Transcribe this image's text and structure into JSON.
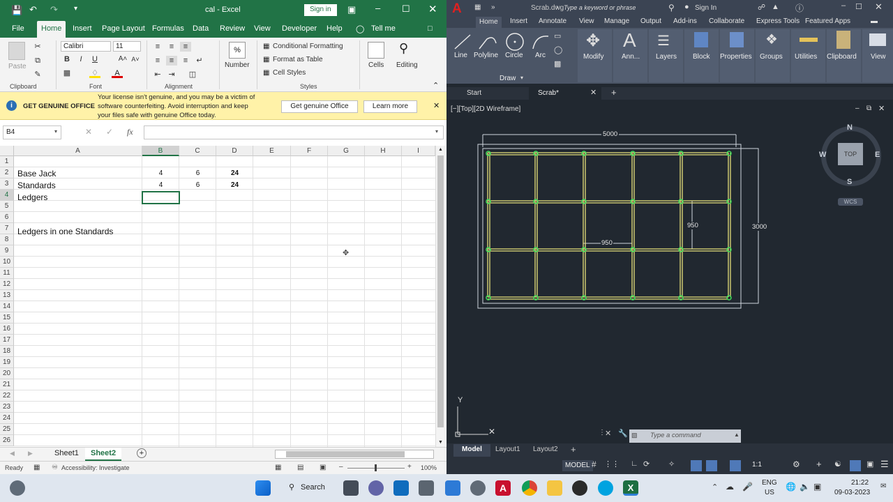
{
  "excel": {
    "title": "cal  -  Excel",
    "sign_in": "Sign in",
    "tabs": [
      "File",
      "Home",
      "Insert",
      "Page Layout",
      "Formulas",
      "Data",
      "Review",
      "View",
      "Developer",
      "Help",
      "Tell me"
    ],
    "font_name": "Calibri",
    "font_size": "11",
    "ribbon": {
      "paste": "Paste",
      "number": "Number",
      "percent": "%",
      "conditional": "Conditional Formatting",
      "format_table": "Format as Table",
      "cell_styles": "Cell Styles",
      "cells": "Cells",
      "editing": "Editing",
      "groups": [
        "Clipboard",
        "Font",
        "Alignment",
        "Styles"
      ]
    },
    "banner": {
      "title": "GET GENUINE OFFICE",
      "message_1": "Your license isn't genuine, and you may be a victim of",
      "message_2": "software counterfeiting. Avoid interruption and keep",
      "message_3": "your files safe with genuine Office today.",
      "btn_genuine": "Get genuine Office",
      "btn_learn": "Learn more"
    },
    "namebox": "B4",
    "fx": "fx",
    "columns": [
      "A",
      "B",
      "C",
      "D",
      "E",
      "F",
      "G",
      "H",
      "I"
    ],
    "rows": [
      "1",
      "2",
      "3",
      "4",
      "5",
      "6",
      "7",
      "8",
      "9",
      "10",
      "11",
      "12",
      "13",
      "14",
      "15",
      "16",
      "17",
      "18",
      "19",
      "20",
      "21",
      "22",
      "23",
      "24",
      "25",
      "26"
    ],
    "cells": {
      "a2": "Base Jack",
      "b2": "4",
      "c2": "6",
      "d2": "24",
      "a3": "Standards",
      "b3": "4",
      "c3": "6",
      "d3": "24",
      "a4": "Ledgers",
      "a7": "Ledgers in one Standards"
    },
    "sheets": [
      "Sheet1",
      "Sheet2"
    ],
    "status_ready": "Ready",
    "accessibility": "Accessibility: Investigate",
    "zoom": "100%"
  },
  "autocad": {
    "file_title": "Scrab.dwg",
    "search_placeholder": "Type a keyword or phrase",
    "sign_in": "Sign In",
    "tabs": [
      "Home",
      "Insert",
      "Annotate",
      "View",
      "Manage",
      "Output",
      "Add-ins",
      "Collaborate",
      "Express Tools",
      "Featured Apps"
    ],
    "draw_tools": [
      "Line",
      "Polyline",
      "Circle",
      "Arc"
    ],
    "draw_group": "Draw",
    "tools": [
      "Modify",
      "Ann...",
      "Layers",
      "Block",
      "Properties",
      "Groups",
      "Utilities",
      "Clipboard",
      "View"
    ],
    "file_tabs": [
      "Start",
      "Scrab*"
    ],
    "viewport_label": "[−][Top][2D Wireframe]",
    "dim_width": "5000",
    "dim_height": "3000",
    "dim_950_v": "950",
    "dim_950_h": "950",
    "compass": {
      "n": "N",
      "s": "S",
      "e": "E",
      "w": "W",
      "top": "TOP",
      "wcs": "WCS"
    },
    "command_placeholder": "Type a command",
    "layouts": [
      "Model",
      "Layout1",
      "Layout2"
    ],
    "model_label": "MODEL",
    "scale": "1:1",
    "colors": {
      "grid_line": "#e6e07a",
      "node": "#3ddc5a",
      "background": "#212830"
    }
  },
  "taskbar": {
    "search": "Search",
    "lang_1": "ENG",
    "lang_2": "US",
    "time": "21:22",
    "date": "09-03-2023"
  }
}
